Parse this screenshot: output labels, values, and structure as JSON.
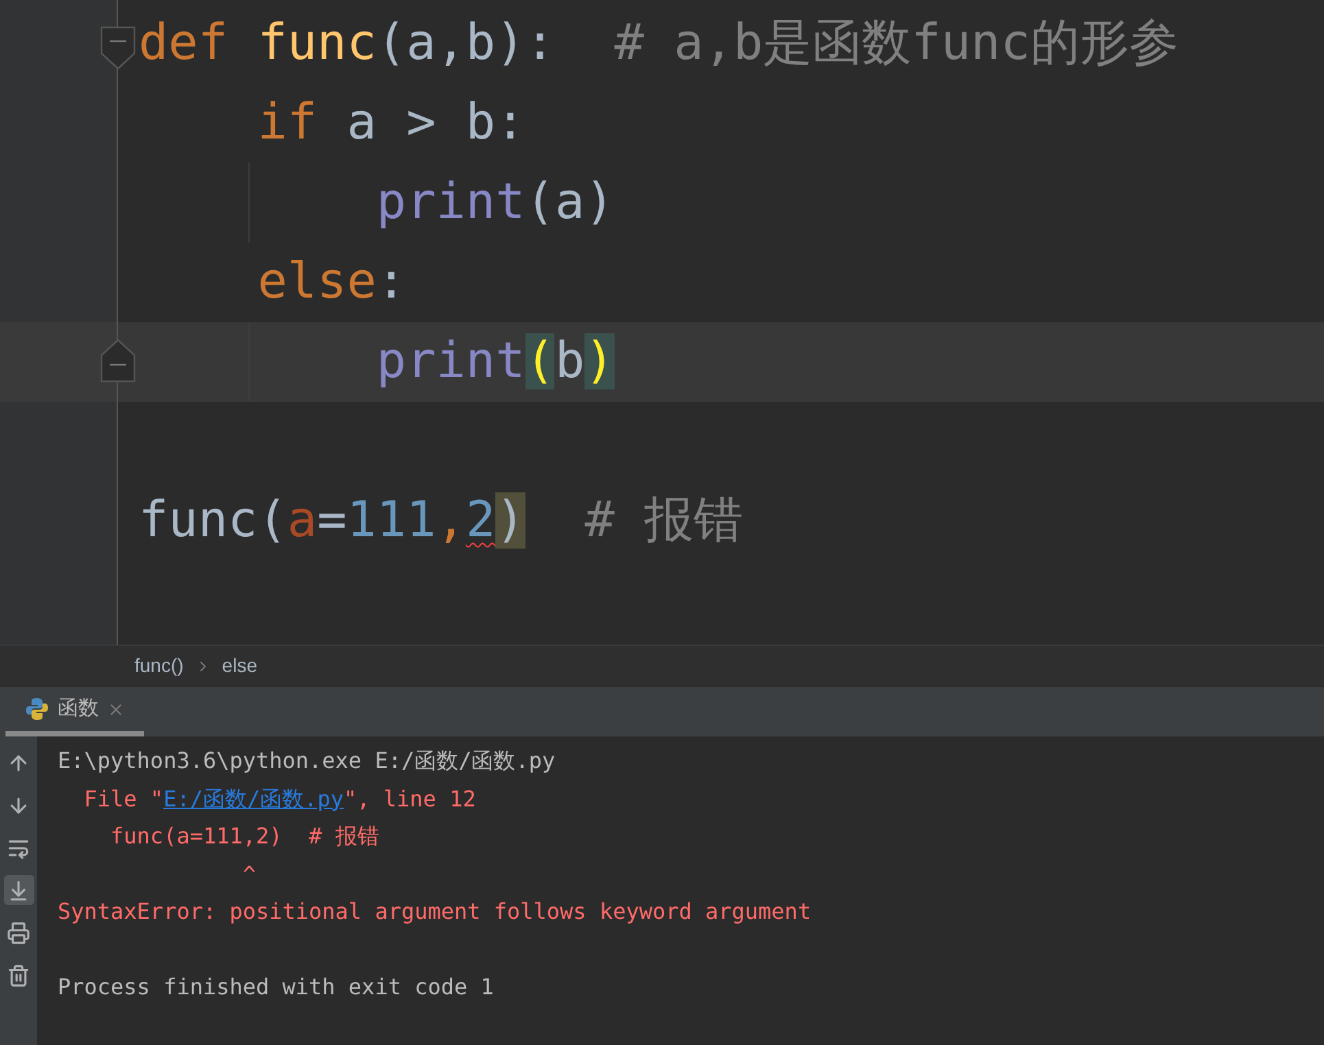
{
  "editor": {
    "lines": [
      {
        "fold_start": true,
        "fold_end": false,
        "current": false,
        "tokens": [
          {
            "text": "def ",
            "kind": "keyword"
          },
          {
            "text": "func",
            "kind": "function"
          },
          {
            "text": "(a,b):  ",
            "kind": "plain"
          },
          {
            "text": "# a,b是函数func的形参",
            "kind": "comment"
          }
        ]
      },
      {
        "fold_start": false,
        "fold_end": false,
        "current": false,
        "tokens": [
          {
            "text": "    if",
            "kind": "keyword"
          },
          {
            "text": " a > b:",
            "kind": "plain"
          }
        ]
      },
      {
        "fold_start": false,
        "fold_end": false,
        "current": false,
        "tokens": [
          {
            "text": "        print",
            "kind": "builtin"
          },
          {
            "text": "(a)",
            "kind": "plain"
          }
        ]
      },
      {
        "fold_start": false,
        "fold_end": false,
        "current": false,
        "tokens": [
          {
            "text": "    else",
            "kind": "keyword"
          },
          {
            "text": ":",
            "kind": "plain"
          }
        ]
      },
      {
        "fold_start": false,
        "fold_end": true,
        "current": true,
        "tokens": [
          {
            "text": "        print",
            "kind": "builtin"
          },
          {
            "text": "(",
            "kind": "brace_match"
          },
          {
            "text": "b",
            "kind": "plain"
          },
          {
            "text": ")",
            "kind": "brace_match"
          }
        ]
      },
      {
        "fold_start": false,
        "fold_end": false,
        "current": false
      },
      {
        "fold_start": false,
        "fold_end": false,
        "current": false,
        "tokens": [
          {
            "text": "func(",
            "kind": "plain"
          },
          {
            "text": "a",
            "kind": "named_arg"
          },
          {
            "text": "=",
            "kind": "plain"
          },
          {
            "text": "111",
            "kind": "number"
          },
          {
            "text": ",",
            "kind": "comma"
          },
          {
            "text": "2",
            "kind": "error"
          },
          {
            "text": ")",
            "kind": "caret_match"
          },
          {
            "text": "  # 报错",
            "kind": "comment"
          }
        ]
      },
      {
        "fold_start": false,
        "fold_end": false,
        "current": false
      }
    ]
  },
  "breadcrumbs": [
    "func()",
    "else"
  ],
  "run_tabs": [
    {
      "label": "函数",
      "selected": true
    }
  ],
  "console_toolbar": [
    {
      "kind": "up",
      "selected": false
    },
    {
      "kind": "down",
      "selected": false
    },
    {
      "kind": "wrap",
      "selected": false
    },
    {
      "kind": "scroll_end",
      "selected": true
    },
    {
      "kind": "print",
      "selected": false
    },
    {
      "kind": "trash",
      "selected": false
    }
  ],
  "console": [
    {
      "kind": "command",
      "segments": [
        {
          "text": "E:\\python3.6\\python.exe E:/函数/函数.py",
          "kind": "text"
        }
      ]
    },
    {
      "kind": "error",
      "segments": [
        {
          "text": "  File \"",
          "kind": "text"
        },
        {
          "text": "E:/函数/函数.py",
          "kind": "link"
        },
        {
          "text": "\", line 12",
          "kind": "text"
        }
      ]
    },
    {
      "kind": "error",
      "segments": [
        {
          "text": "    func(a=111,2)  # 报错",
          "kind": "text"
        }
      ]
    },
    {
      "kind": "error",
      "segments": [
        {
          "text": "              ^",
          "kind": "text"
        }
      ]
    },
    {
      "kind": "error",
      "segments": [
        {
          "text": "SyntaxError: positional argument follows keyword argument",
          "kind": "text"
        }
      ]
    },
    {
      "kind": "exit",
      "segments": [
        {
          "text": "Process finished with exit code 1",
          "kind": "text"
        }
      ]
    }
  ]
}
